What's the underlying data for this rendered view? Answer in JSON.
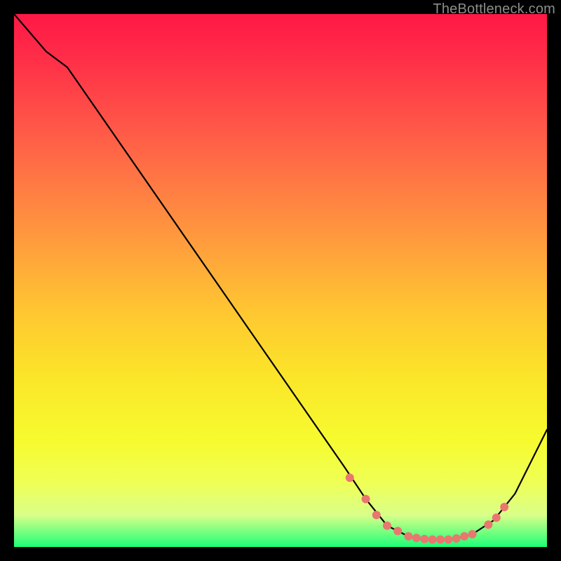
{
  "watermark": "TheBottleneck.com",
  "chart_data": {
    "type": "line",
    "title": "",
    "xlabel": "",
    "ylabel": "",
    "xlim": [
      0,
      100
    ],
    "ylim": [
      0,
      100
    ],
    "curve": [
      {
        "x": 0,
        "y": 100
      },
      {
        "x": 6,
        "y": 93
      },
      {
        "x": 10,
        "y": 90
      },
      {
        "x": 62,
        "y": 15
      },
      {
        "x": 66,
        "y": 9
      },
      {
        "x": 70,
        "y": 4
      },
      {
        "x": 74,
        "y": 2
      },
      {
        "x": 78,
        "y": 1.4
      },
      {
        "x": 82,
        "y": 1.4
      },
      {
        "x": 86,
        "y": 2.4
      },
      {
        "x": 90,
        "y": 5
      },
      {
        "x": 94,
        "y": 10
      },
      {
        "x": 100,
        "y": 22
      }
    ],
    "markers": [
      {
        "x": 63,
        "y": 13
      },
      {
        "x": 66,
        "y": 9
      },
      {
        "x": 68,
        "y": 6
      },
      {
        "x": 70,
        "y": 4
      },
      {
        "x": 72,
        "y": 3
      },
      {
        "x": 74,
        "y": 2
      },
      {
        "x": 75.5,
        "y": 1.7
      },
      {
        "x": 77,
        "y": 1.5
      },
      {
        "x": 78.5,
        "y": 1.4
      },
      {
        "x": 80,
        "y": 1.4
      },
      {
        "x": 81.5,
        "y": 1.4
      },
      {
        "x": 83,
        "y": 1.6
      },
      {
        "x": 84.5,
        "y": 2.0
      },
      {
        "x": 86,
        "y": 2.4
      },
      {
        "x": 89,
        "y": 4.2
      },
      {
        "x": 90.5,
        "y": 5.5
      },
      {
        "x": 92,
        "y": 7.5
      }
    ],
    "marker_color": "#e9776f",
    "line_color": "#000000"
  }
}
